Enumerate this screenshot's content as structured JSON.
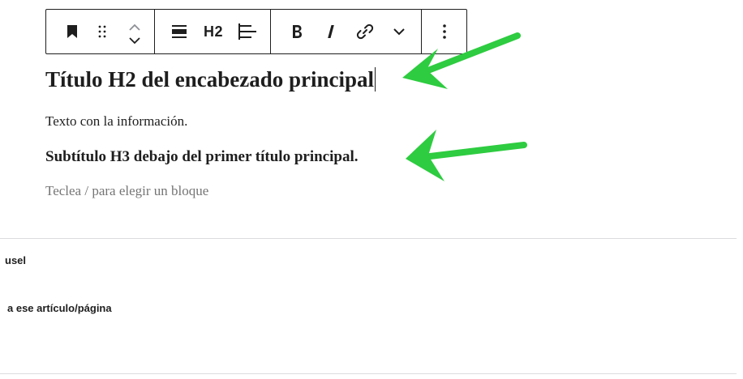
{
  "toolbar": {
    "heading_level": "H2",
    "buttons": [
      {
        "name": "bookmark-icon",
        "tooltip": ""
      },
      {
        "name": "drag-handle-icon",
        "tooltip": ""
      },
      {
        "name": "move-up-icon",
        "tooltip": ""
      },
      {
        "name": "move-down-icon",
        "tooltip": ""
      },
      {
        "name": "align-wide-icon",
        "tooltip": ""
      },
      {
        "name": "text-align-left-icon",
        "tooltip": ""
      },
      {
        "name": "bold-icon",
        "tooltip": ""
      },
      {
        "name": "italic-icon",
        "tooltip": ""
      },
      {
        "name": "link-icon",
        "tooltip": ""
      },
      {
        "name": "chevron-down-icon",
        "tooltip": ""
      },
      {
        "name": "more-options-icon",
        "tooltip": ""
      }
    ]
  },
  "content": {
    "h2_text": "Título H2 del encabezado principal",
    "paragraph_text": "Texto con la información.",
    "h3_text": "Subtítulo H3 debajo del primer título principal.",
    "placeholder_text": "Teclea / para elegir un bloque"
  },
  "panels": {
    "panel1_label": "usel",
    "panel2_label": "a ese artículo/página"
  },
  "colors": {
    "arrow": "#2ecc40",
    "text": "#1e1e1e",
    "placeholder": "#757575",
    "divider": "#dcdcde"
  }
}
